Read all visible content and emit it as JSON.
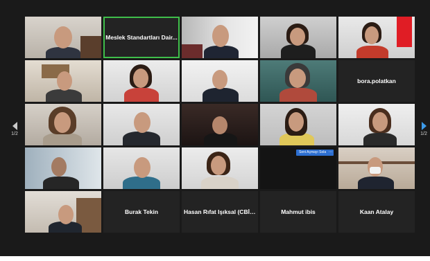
{
  "nav": {
    "page_indicator_left": "1/2",
    "page_indicator_right": "1/2",
    "prev_icon": "chevron-left-icon",
    "next_icon": "chevron-right-icon"
  },
  "caption_chip": {
    "label": "Seni Açmayı Sola"
  },
  "participants": [
    {
      "id": "r1c1",
      "type": "video"
    },
    {
      "id": "r1c2",
      "type": "name",
      "name": "Meslek Standartları Dair..."
    },
    {
      "id": "r1c3",
      "type": "video"
    },
    {
      "id": "r1c4",
      "type": "video"
    },
    {
      "id": "r1c5",
      "type": "video"
    },
    {
      "id": "r2c1",
      "type": "video"
    },
    {
      "id": "r2c2",
      "type": "video"
    },
    {
      "id": "r2c3",
      "type": "video"
    },
    {
      "id": "r2c4",
      "type": "video"
    },
    {
      "id": "r2c5",
      "type": "name",
      "name": "bora.polatkan"
    },
    {
      "id": "r3c1",
      "type": "video"
    },
    {
      "id": "r3c2",
      "type": "video"
    },
    {
      "id": "r3c3",
      "type": "video"
    },
    {
      "id": "r3c4",
      "type": "video"
    },
    {
      "id": "r3c5",
      "type": "video"
    },
    {
      "id": "r4c1",
      "type": "video"
    },
    {
      "id": "r4c2",
      "type": "video"
    },
    {
      "id": "r4c3",
      "type": "video"
    },
    {
      "id": "r4c4",
      "type": "video"
    },
    {
      "id": "r4c5",
      "type": "video"
    },
    {
      "id": "r5c1",
      "type": "video"
    },
    {
      "id": "r5c2",
      "type": "name",
      "name": "Burak Tekin"
    },
    {
      "id": "r5c3",
      "type": "name",
      "name": "Hasan Rıfat Işıksal (CBİK..."
    },
    {
      "id": "r5c4",
      "type": "name",
      "name": "Mahmut ibis"
    },
    {
      "id": "r5c5",
      "type": "name",
      "name": "Kaan Atalay"
    }
  ],
  "colors": {
    "background": "#1a1a1a",
    "speaking_border": "#3fbf4a",
    "accent": "#3d9be9"
  }
}
